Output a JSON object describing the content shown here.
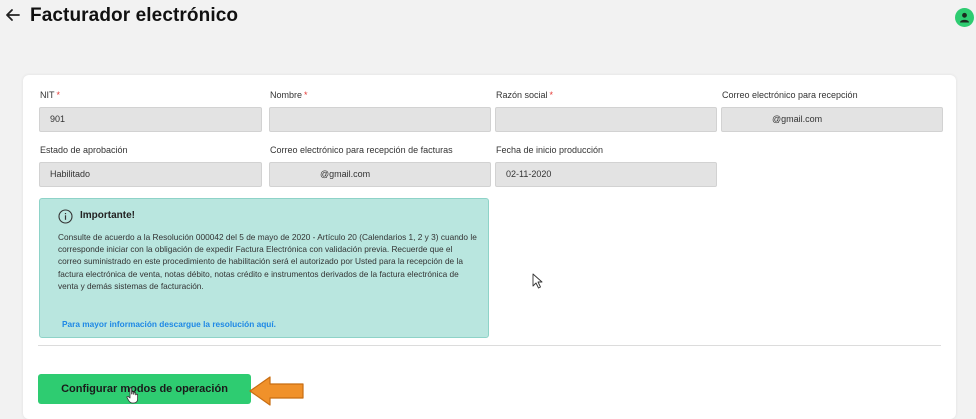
{
  "header": {
    "title": "Facturador electrónico"
  },
  "form": {
    "nit": {
      "label": "NIT",
      "required": "*",
      "value": "901"
    },
    "nombre": {
      "label": "Nombre",
      "required": "*",
      "value": ""
    },
    "razon_social": {
      "label": "Razón social",
      "required": "*",
      "value": ""
    },
    "correo_recepcion": {
      "label": "Correo electrónico para recepción",
      "value": "@gmail.com"
    },
    "estado_aprobacion": {
      "label": "Estado de aprobación",
      "value": "Habilitado"
    },
    "correo_facturas": {
      "label": "Correo electrónico para recepción de facturas",
      "value": "@gmail.com"
    },
    "fecha_inicio": {
      "label": "Fecha de inicio producción",
      "value": "02-11-2020"
    }
  },
  "notice": {
    "title": "Importante!",
    "body": "Consulte de acuerdo a la Resolución 000042 del 5 de mayo de 2020 - Artículo 20 (Calendarios 1, 2 y 3) cuando le corresponde iniciar con la obligación de expedir Factura Electrónica con validación previa. Recuerde que el correo suministrado en este procedimiento de habilitación será el autorizado por Usted para la recepción de la factura electrónica de venta, notas débito, notas crédito e instrumentos derivados de la factura electrónica de venta y demás sistemas de facturación.",
    "link": "Para mayor información descargue la resolución aquí."
  },
  "actions": {
    "configure_label": "Configurar modos de operación"
  },
  "colors": {
    "accent": "#2ecc71",
    "notice_bg": "#b9e6df",
    "link": "#1e88e5",
    "pointer_arrow": "#f0912a"
  }
}
